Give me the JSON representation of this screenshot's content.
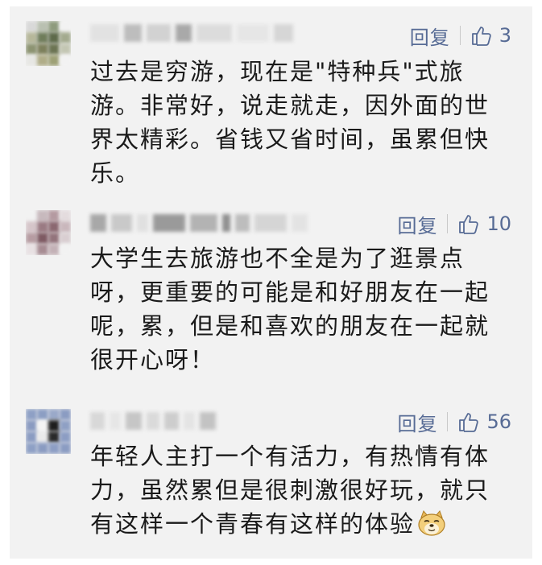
{
  "comments": [
    {
      "reply_label": "回复",
      "like_count": "3",
      "text": "过去是穷游，现在是\"特种兵\"式旅游。非常好，说走就走，因外面的世界太精彩。省钱又省时间，虽累但快乐。"
    },
    {
      "reply_label": "回复",
      "like_count": "10",
      "text": "大学生去旅游也不全是为了逛景点呀，更重要的可能是和好朋友在一起呢，累，但是和喜欢的朋友在一起就很开心呀！"
    },
    {
      "reply_label": "回复",
      "like_count": "56",
      "text": "年轻人主打一个有活力，有热情有体力，虽然累但是很刺激很好玩，就只有这样一个青春有这样的体验",
      "emoji": "doge-emoji"
    }
  ],
  "icons": {
    "like": "thumbs-up-icon"
  },
  "colors": {
    "link": "#576b95",
    "text": "#1a1a1a",
    "panel": "#f2f2f2"
  }
}
